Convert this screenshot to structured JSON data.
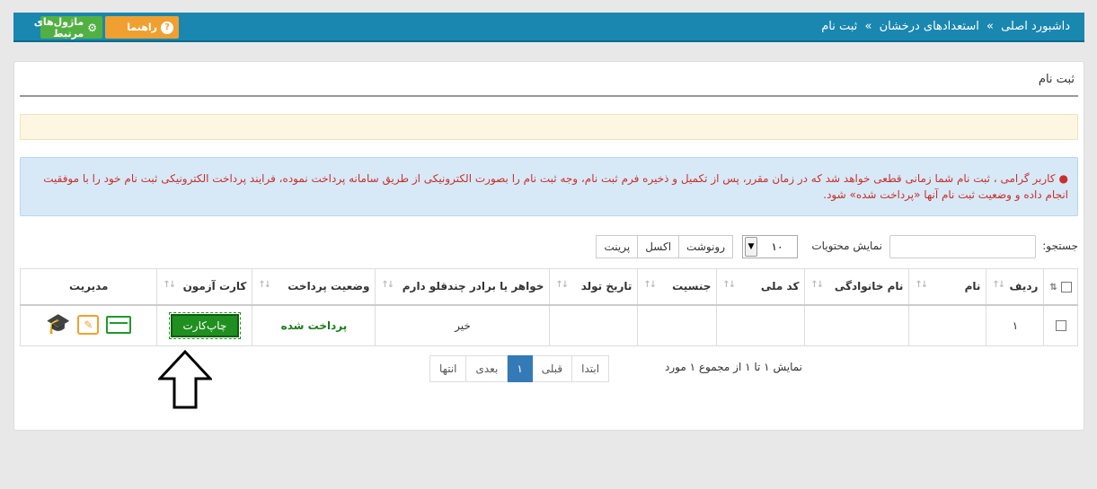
{
  "breadcrumb": {
    "home": "داشبورد اصلی",
    "sep1": "»",
    "section": "استعدادهای درخشان",
    "sep2": "»",
    "current": "ثبت نام"
  },
  "topbar": {
    "help_label": "راهنما",
    "modules_label": "ماژول‌های مرتبط"
  },
  "panel": {
    "title": "ثبت نام",
    "alert_text": "کاربر گرامی ، ثبت نام شما زمانی قطعی خواهد شد که در زمان مقرر، پس از تکمیل و ذخیره فرم ثبت نام، وجه ثبت نام را بصورت الکترونیکی از طریق سامانه پرداخت نموده، فرایند پرداخت الکترونیکی ثبت نام خود را با موفقیت انجام داده و وضعیت ثبت نام آنها «پرداخت شده» شود."
  },
  "controls": {
    "search_label": "جستجو:",
    "search_value": "",
    "show_label": "نمایش محتویات",
    "page_size": "۱۰",
    "export_buttons": [
      "رونوشت",
      "اکسل",
      "پرینت"
    ]
  },
  "table": {
    "headers": [
      "ردیف",
      "نام",
      "نام خانوادگی",
      "کد ملی",
      "جنسیت",
      "تاریخ تولد",
      "خواهر یا برادر چندقلو دارم",
      "وضعیت پرداخت",
      "کارت آزمون",
      "مدیریت"
    ],
    "rows": [
      {
        "index": "۱",
        "first_name": "",
        "last_name": "",
        "national_code": "",
        "gender": "",
        "birth_date": "",
        "twin": "خیر",
        "payment_status": "پرداخت شده",
        "card_button": "چاپ‌کارت"
      }
    ]
  },
  "pager": {
    "info": "نمایش ۱ تا ۱ از مجموع ۱ مورد",
    "first": "ابتدا",
    "prev": "قبلی",
    "current": "۱",
    "next": "بعدی",
    "last": "انتها"
  },
  "icons": {
    "help": "question-icon",
    "modules": "gears-icon",
    "card": "credit-card-icon",
    "edit": "edit-icon",
    "grad": "graduation-cap-icon",
    "annotation": "up-arrow-icon"
  },
  "colors": {
    "topbar": "#1a87b0",
    "help": "#f0a030",
    "modules": "#52b043",
    "alert_text": "#c9302c",
    "paid": "#1c7a1c",
    "print_btn": "#1f8f1f",
    "pager_active": "#337ab7"
  }
}
